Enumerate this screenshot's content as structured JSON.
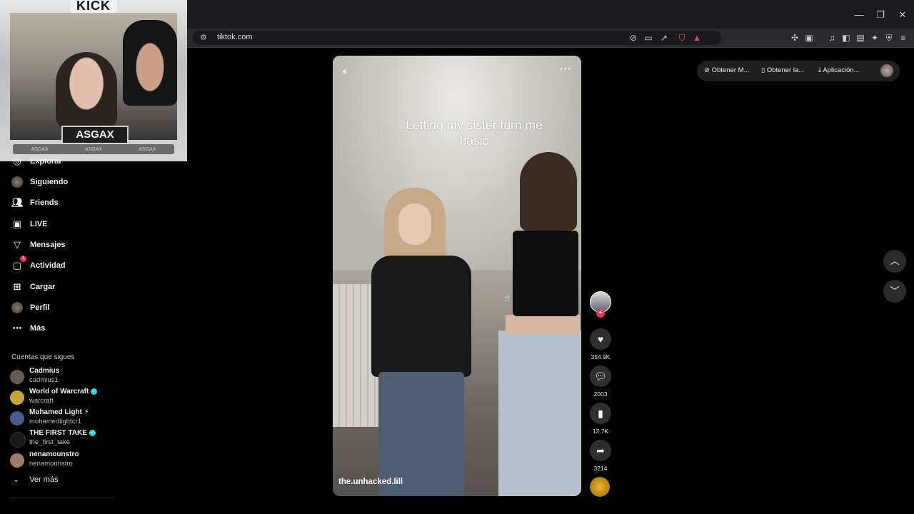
{
  "browser": {
    "url": "tiktok.com",
    "window_controls": [
      "—",
      "❐",
      "✕"
    ]
  },
  "stream_overlay": {
    "platform_logo": "KICK",
    "streamer": "ASGAX",
    "socials": [
      "ASGAX",
      "ASGAX",
      "ASGAX"
    ]
  },
  "sidebar": {
    "items": [
      {
        "label": "Explorar",
        "icon": "compass-icon"
      },
      {
        "label": "Siguiendo",
        "icon": "avatar"
      },
      {
        "label": "Friends",
        "icon": "friends-icon"
      },
      {
        "label": "LIVE",
        "icon": "live-icon"
      },
      {
        "label": "Mensajes",
        "icon": "send-icon"
      },
      {
        "label": "Actividad",
        "icon": "activity-icon",
        "badge": "1"
      },
      {
        "label": "Cargar",
        "icon": "plus-square-icon"
      },
      {
        "label": "Perfil",
        "icon": "avatar"
      },
      {
        "label": "Más",
        "icon": "more-icon"
      }
    ],
    "following_title": "Cuentas que sigues",
    "following": [
      {
        "name": "Cadmius",
        "handle": "cadmius1",
        "verified": false,
        "color": "#6b5a52"
      },
      {
        "name": "World of Warcraft",
        "handle": "warcraft",
        "verified": true,
        "color": "#c8a33a"
      },
      {
        "name": "Mohamed Light ⚡",
        "handle": "mohamedlightcr1",
        "verified": false,
        "color": "#4a5a8a"
      },
      {
        "name": "THE FIRST TAKE",
        "handle": "the_first_take",
        "verified": true,
        "color": "#1a1a1a"
      },
      {
        "name": "nenamounstro",
        "handle": "nenamounstro",
        "verified": false,
        "color": "#a07b68"
      }
    ],
    "see_more": "Ver más"
  },
  "topbar": {
    "pills": [
      "Obtener M...",
      "Obtener la...",
      "Aplicación..."
    ]
  },
  "video": {
    "caption": "Letting my sister turn me basic",
    "username": "the.unhacked.lill"
  },
  "actions": {
    "likes": "354.9K",
    "comments": "2003",
    "saves": "12.7K",
    "shares": "3214"
  },
  "colors": {
    "accent": "#fe2c55",
    "verified": "#20d5ec"
  }
}
